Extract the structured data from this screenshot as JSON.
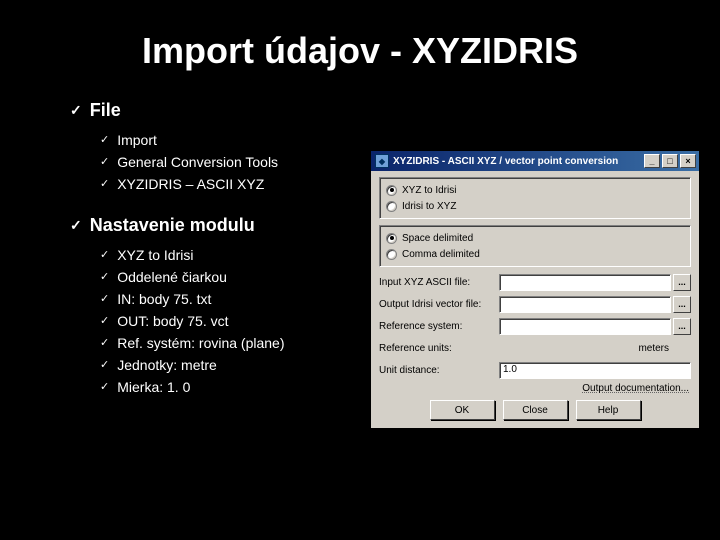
{
  "title": "Import údajov - XYZIDRIS",
  "sections": [
    {
      "heading": "File",
      "items": [
        "Import",
        "General Conversion Tools",
        "XYZIDRIS – ASCII XYZ"
      ]
    },
    {
      "heading": "Nastavenie modulu",
      "items": [
        "XYZ to Idrisi",
        "Oddelené čiarkou",
        "IN: body 75. txt",
        "OUT: body 75. vct",
        "Ref. systém: rovina (plane)",
        "Jednotky: metre",
        "Mierka: 1. 0"
      ]
    }
  ],
  "dialog": {
    "title": "XYZIDRIS - ASCII XYZ / vector point conversion",
    "direction": {
      "opt1": "XYZ to Idrisi",
      "opt2": "Idrisi to XYZ"
    },
    "delimiter": {
      "opt1": "Space delimited",
      "opt2": "Comma delimited"
    },
    "fields": {
      "input_label": "Input XYZ ASCII file:",
      "output_label": "Output Idrisi vector file:",
      "refsys_label": "Reference system:",
      "refunits_label": "Reference units:",
      "refunits_value": "meters",
      "unitdist_label": "Unit distance:",
      "unitdist_value": "1.0"
    },
    "outdoc": "Output documentation...",
    "buttons": {
      "ok": "OK",
      "close": "Close",
      "help": "Help"
    },
    "winbtns": {
      "min": "_",
      "max": "□",
      "close": "×"
    }
  }
}
